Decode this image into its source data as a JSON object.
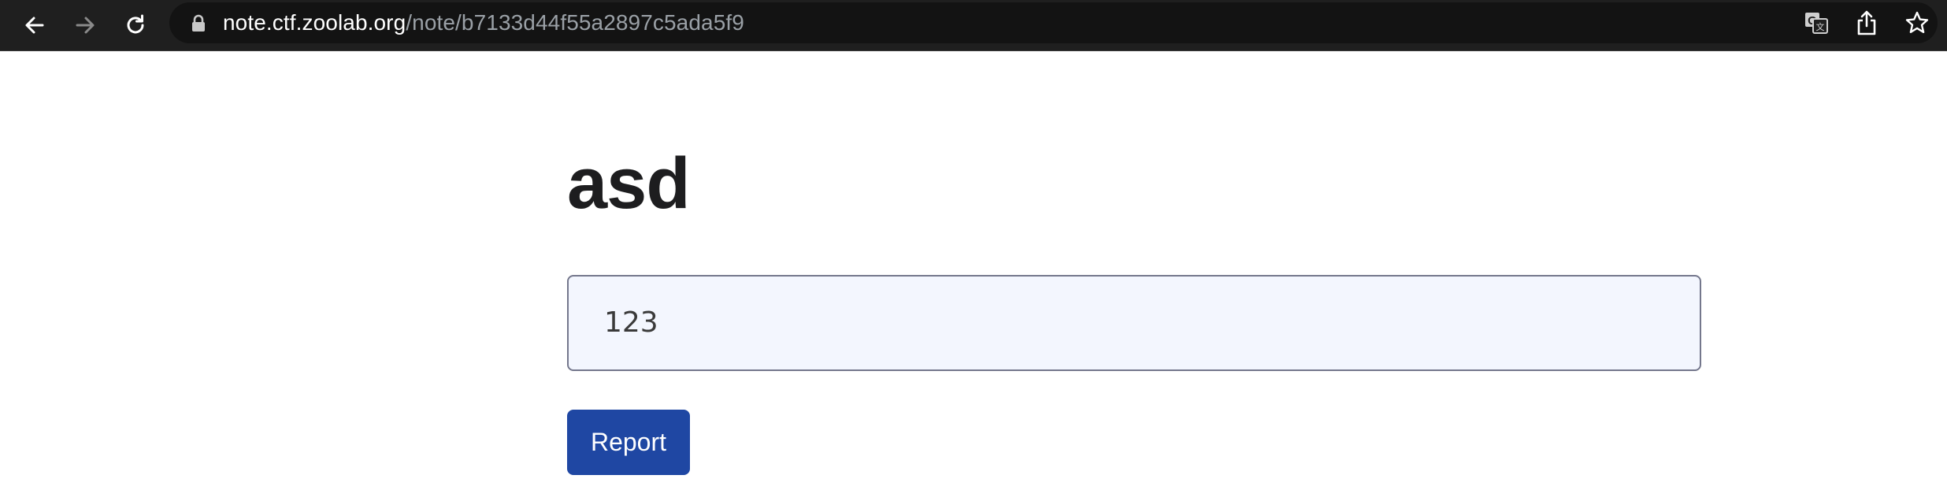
{
  "browser": {
    "url_host": "note.ctf.zoolab.org",
    "url_path": "/note/b7133d44f55a2897c5ada5f9",
    "icons": {
      "back": "back-arrow-icon",
      "forward": "forward-arrow-icon",
      "reload": "reload-icon",
      "lock": "lock-icon",
      "translate": "translate-icon",
      "share": "share-icon",
      "bookmark": "bookmark-star-icon"
    }
  },
  "note": {
    "title": "asd",
    "body": "123"
  },
  "actions": {
    "report_label": "Report"
  },
  "colors": {
    "toolbar_bg": "#1f1f1f",
    "omnibox_bg": "#131313",
    "note_body_bg": "#f3f6fe",
    "note_body_border": "#74778c",
    "report_button_bg": "#1f47a3"
  }
}
